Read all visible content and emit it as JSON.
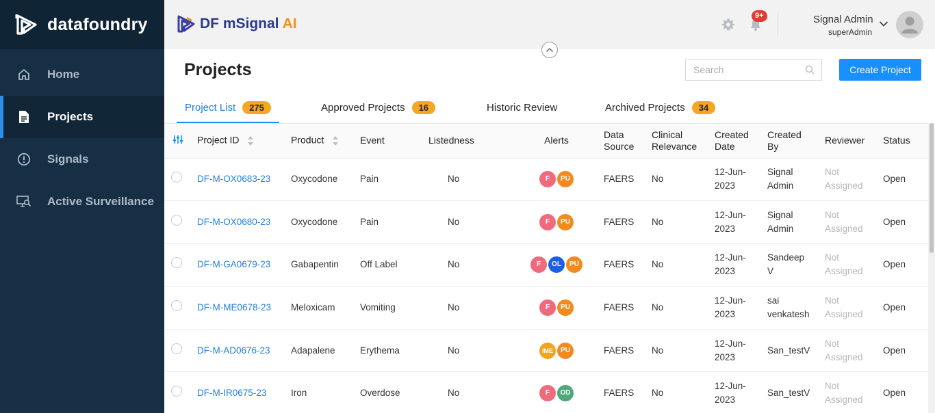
{
  "brand": {
    "name": "datafoundry"
  },
  "sidebar": {
    "items": [
      {
        "label": "Home",
        "icon": "home-icon",
        "active": false
      },
      {
        "label": "Projects",
        "icon": "document-icon",
        "active": true
      },
      {
        "label": "Signals",
        "icon": "alert-circle-icon",
        "active": false
      },
      {
        "label": "Active Surveillance",
        "icon": "monitor-search-icon",
        "active": false
      }
    ]
  },
  "topbar": {
    "app_title_main": "DF mSignal",
    "app_title_ai": "AI",
    "notification_badge": "9+",
    "user_name": "Signal Admin",
    "user_role": "superAdmin"
  },
  "page": {
    "title": "Projects",
    "search_placeholder": "Search",
    "create_button": "Create Project"
  },
  "tabs": [
    {
      "label": "Project List",
      "count": "275",
      "active": true
    },
    {
      "label": "Approved Projects",
      "count": "16",
      "active": false
    },
    {
      "label": "Historic Review",
      "count": "",
      "active": false
    },
    {
      "label": "Archived Projects",
      "count": "34",
      "active": false
    }
  ],
  "table": {
    "columns": {
      "project_id": "Project ID",
      "product": "Product",
      "event": "Event",
      "listedness": "Listedness",
      "alerts": "Alerts",
      "data_source_1": "Data",
      "data_source_2": "Source",
      "clinical_1": "Clinical",
      "clinical_2": "Relevance",
      "created_date_1": "Created",
      "created_date_2": "Date",
      "created_by_1": "Created",
      "created_by_2": "By",
      "reviewer": "Reviewer",
      "status": "Status"
    },
    "rows": [
      {
        "project_id": "DF-M-OX0683-23",
        "product": "Oxycodone",
        "event": "Pain",
        "listedness": "No",
        "alerts": [
          "F",
          "PU"
        ],
        "data_source": "FAERS",
        "clinical_relevance": "No",
        "created_date_1": "12-Jun-",
        "created_date_2": "2023",
        "created_by_1": "Signal",
        "created_by_2": "Admin",
        "reviewer_1": "Not",
        "reviewer_2": "Assigned",
        "status": "Open"
      },
      {
        "project_id": "DF-M-OX0680-23",
        "product": "Oxycodone",
        "event": "Pain",
        "listedness": "No",
        "alerts": [
          "F",
          "PU"
        ],
        "data_source": "FAERS",
        "clinical_relevance": "No",
        "created_date_1": "12-Jun-",
        "created_date_2": "2023",
        "created_by_1": "Signal",
        "created_by_2": "Admin",
        "reviewer_1": "Not",
        "reviewer_2": "Assigned",
        "status": "Open"
      },
      {
        "project_id": "DF-M-GA0679-23",
        "product": "Gabapentin",
        "event": "Off Label",
        "listedness": "No",
        "alerts": [
          "F",
          "OL",
          "PU"
        ],
        "data_source": "FAERS",
        "clinical_relevance": "No",
        "created_date_1": "12-Jun-",
        "created_date_2": "2023",
        "created_by_1": "Sandeep",
        "created_by_2": "V",
        "reviewer_1": "Not",
        "reviewer_2": "Assigned",
        "status": "Open"
      },
      {
        "project_id": "DF-M-ME0678-23",
        "product": "Meloxicam",
        "event": "Vomiting",
        "listedness": "No",
        "alerts": [
          "F",
          "PU"
        ],
        "data_source": "FAERS",
        "clinical_relevance": "No",
        "created_date_1": "12-Jun-",
        "created_date_2": "2023",
        "created_by_1": "sai",
        "created_by_2": "venkatesh",
        "reviewer_1": "Not",
        "reviewer_2": "Assigned",
        "status": "Open"
      },
      {
        "project_id": "DF-M-AD0676-23",
        "product": "Adapalene",
        "event": "Erythema",
        "listedness": "No",
        "alerts": [
          "IME",
          "PU"
        ],
        "data_source": "FAERS",
        "clinical_relevance": "No",
        "created_date_1": "12-Jun-",
        "created_date_2": "2023",
        "created_by_1": "San_testV",
        "created_by_2": "",
        "reviewer_1": "Not",
        "reviewer_2": "Assigned",
        "status": "Open"
      },
      {
        "project_id": "DF-M-IR0675-23",
        "product": "Iron",
        "event": "Overdose",
        "listedness": "No",
        "alerts": [
          "F",
          "OD"
        ],
        "data_source": "FAERS",
        "clinical_relevance": "No",
        "created_date_1": "12-Jun-",
        "created_date_2": "2023",
        "created_by_1": "San_testV",
        "created_by_2": "",
        "reviewer_1": "Not",
        "reviewer_2": "Assigned",
        "status": "Open"
      }
    ]
  },
  "alert_colors": {
    "F": "#f06a7e",
    "PU": "#f38a1e",
    "OL": "#1b5fe6",
    "IME": "#f3a41e",
    "OD": "#4ea878"
  },
  "colors": {
    "sidebar_bg": "#162f45",
    "accent": "#1890ff",
    "badge": "#f5a623"
  }
}
